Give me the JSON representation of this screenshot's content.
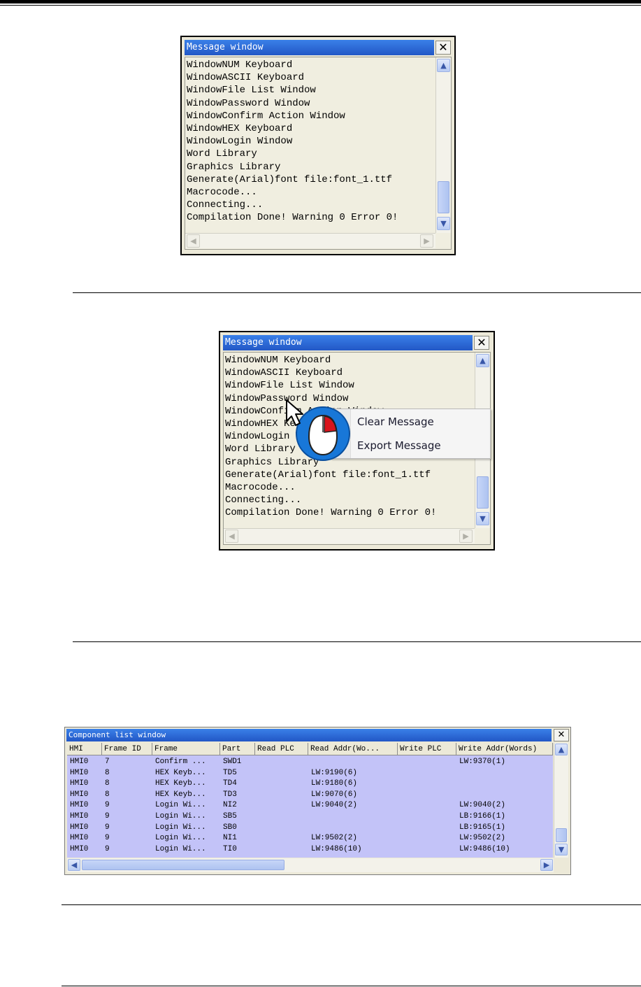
{
  "message_window": {
    "title": "Message window",
    "close_glyph": "✕",
    "lines": [
      "WindowNUM Keyboard",
      "WindowASCII Keyboard",
      "WindowFile List Window",
      "WindowPassword Window",
      "WindowConfirm Action Window",
      "WindowHEX Keyboard",
      "WindowLogin Window",
      "Word Library",
      "Graphics Library",
      "Generate(Arial)font file:font_1.ttf",
      "Macrocode...",
      "Connecting...",
      "Compilation Done! Warning 0 Error 0!"
    ]
  },
  "context_menu": {
    "items": [
      "Clear Message",
      "Export Message"
    ]
  },
  "component_list": {
    "title": "Component list window",
    "columns": [
      "HMI",
      "Frame ID",
      "Frame",
      "Part",
      "Read PLC",
      "Read Addr(Wo...",
      "Write PLC",
      "Write Addr(Words)"
    ],
    "rows": [
      [
        "HMI0",
        "7",
        "Confirm ...",
        "SWD1",
        "",
        "",
        "",
        "LW:9370(1)"
      ],
      [
        "HMI0",
        "8",
        "HEX Keyb...",
        "TD5",
        "",
        "LW:9190(6)",
        "",
        ""
      ],
      [
        "HMI0",
        "8",
        "HEX Keyb...",
        "TD4",
        "",
        "LW:9180(6)",
        "",
        ""
      ],
      [
        "HMI0",
        "8",
        "HEX Keyb...",
        "TD3",
        "",
        "LW:9070(6)",
        "",
        ""
      ],
      [
        "HMI0",
        "9",
        "Login Wi...",
        "NI2",
        "",
        "LW:9040(2)",
        "",
        "LW:9040(2)"
      ],
      [
        "HMI0",
        "9",
        "Login Wi...",
        "SB5",
        "",
        "",
        "",
        "LB:9166(1)"
      ],
      [
        "HMI0",
        "9",
        "Login Wi...",
        "SB0",
        "",
        "",
        "",
        "LB:9165(1)"
      ],
      [
        "HMI0",
        "9",
        "Login Wi...",
        "NI1",
        "",
        "LW:9502(2)",
        "",
        "LW:9502(2)"
      ],
      [
        "HMI0",
        "9",
        "Login Wi...",
        "TI0",
        "",
        "LW:9486(10)",
        "",
        "LW:9486(10)"
      ]
    ]
  },
  "colors": {
    "titlebar": "#2e6fd9",
    "grid_row_bg": "#c3c3f8",
    "window_bg": "#ece9d8"
  }
}
